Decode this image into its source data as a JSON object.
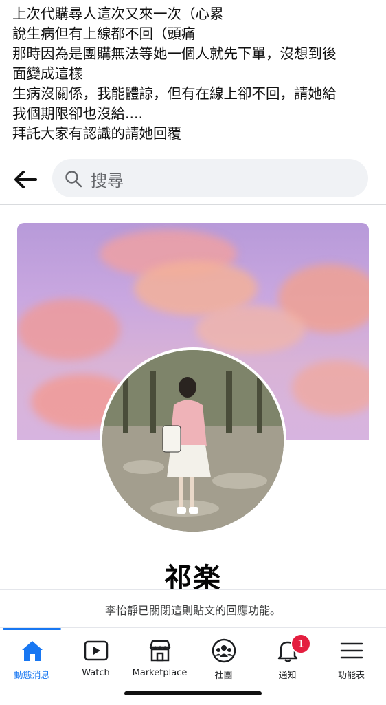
{
  "post": {
    "lines": [
      "上次代購尋人這次又來一次（心累",
      "說生病但有上線都不回（頭痛",
      "那時因為是團購無法等她一個人就先下單，沒想到後",
      "面變成這樣",
      "生病沒關係，我能體諒，但有在線上卻不回，請她給",
      "我個期限卻也沒給....",
      "拜託大家有認識的請她回覆"
    ]
  },
  "header": {
    "back_icon": "arrow-left-icon",
    "search_placeholder": "搜尋",
    "search_icon": "search-icon"
  },
  "profile": {
    "name": "祁楽",
    "cover_colors": [
      "#b79ad9",
      "#f3a58f",
      "#e98a8a"
    ]
  },
  "notice": {
    "closed_text": "李怡靜已關閉這則貼文的回應功能。"
  },
  "tabbar": {
    "tabs": [
      {
        "label": "動態消息",
        "icon": "home-icon",
        "active": true
      },
      {
        "label": "Watch",
        "icon": "watch-icon",
        "active": false
      },
      {
        "label": "Marketplace",
        "icon": "marketplace-icon",
        "active": false
      },
      {
        "label": "社團",
        "icon": "groups-icon",
        "active": false
      },
      {
        "label": "通知",
        "icon": "bell-icon",
        "active": false,
        "badge": "1"
      },
      {
        "label": "功能表",
        "icon": "menu-icon",
        "active": false
      }
    ]
  },
  "colors": {
    "accent": "#1877f2",
    "badge": "#e41e3f"
  }
}
